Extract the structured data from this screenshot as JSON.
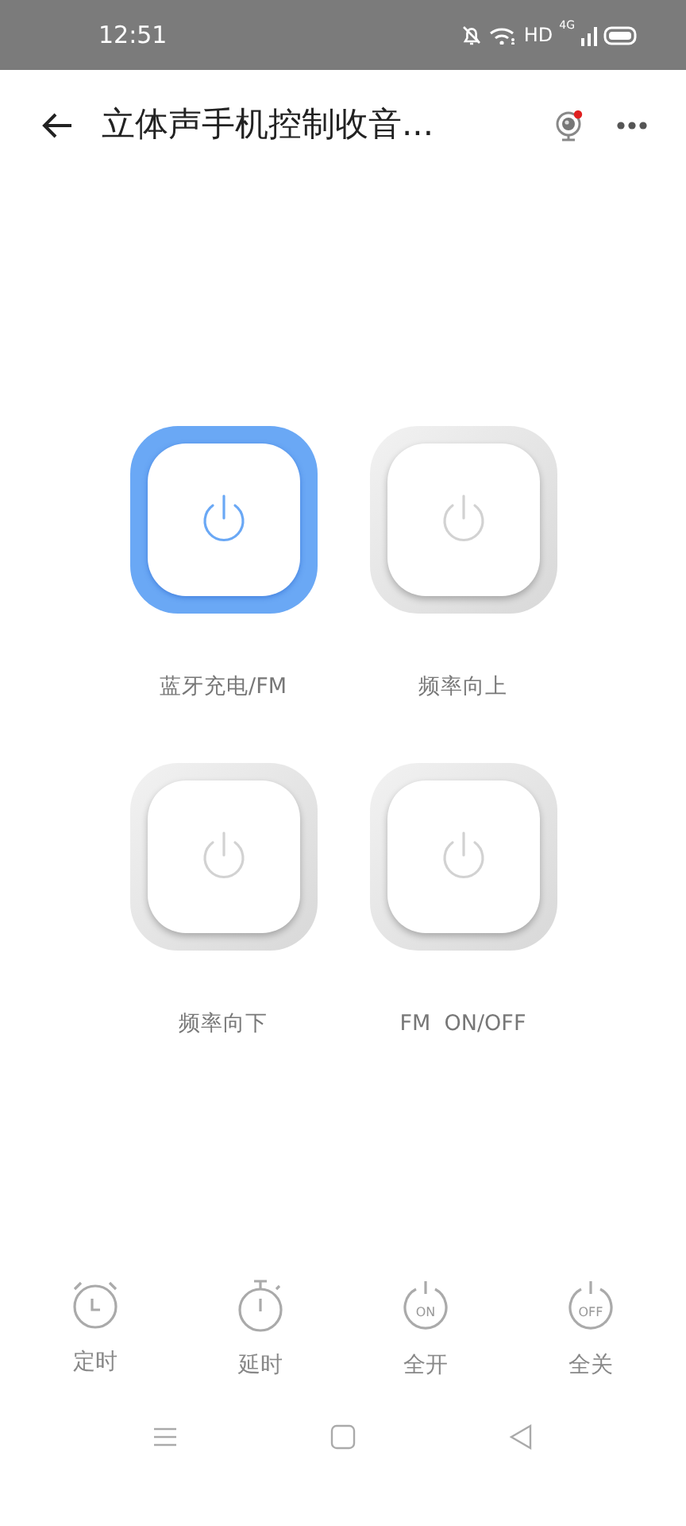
{
  "status_bar": {
    "time": "12:51",
    "hd": "HD",
    "network": "4G"
  },
  "header": {
    "title": "立体声手机控制收音...",
    "camera_notification": true
  },
  "switches": [
    {
      "label": "蓝牙充电/FM",
      "on": true
    },
    {
      "label": "频率向上",
      "on": false
    },
    {
      "label": "频率向下",
      "on": false
    },
    {
      "label": "FM  ON/OFF",
      "on": false
    }
  ],
  "actions": [
    {
      "kind": "alarm",
      "label": "定时"
    },
    {
      "kind": "stopwatch",
      "label": "延时"
    },
    {
      "kind": "power",
      "icon_text": "ON",
      "label": "全开"
    },
    {
      "kind": "power",
      "icon_text": "OFF",
      "label": "全关"
    }
  ]
}
